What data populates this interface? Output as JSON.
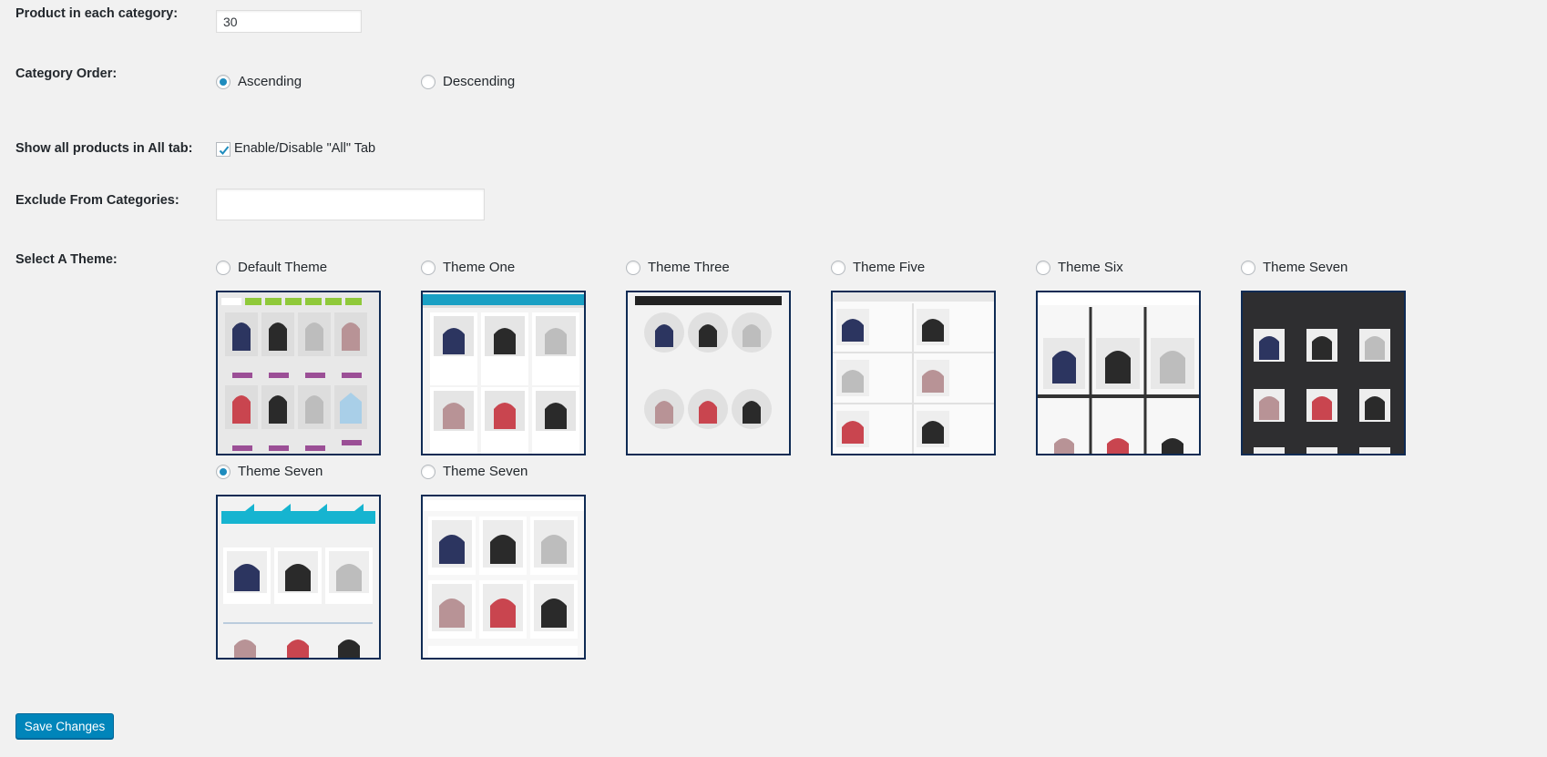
{
  "settings": {
    "product_count": {
      "label": "Product in each category:",
      "value": "30"
    },
    "category_order": {
      "label": "Category Order:",
      "options": [
        {
          "label": "Ascending",
          "checked": true
        },
        {
          "label": "Descending",
          "checked": false
        }
      ]
    },
    "all_tab": {
      "label": "Show all products in All tab:",
      "checkbox_label": "Enable/Disable \"All\" Tab",
      "checked": true
    },
    "exclude": {
      "label": "Exclude From Categories:",
      "value": ""
    },
    "theme": {
      "label": "Select A Theme:",
      "options": [
        {
          "label": "Default Theme",
          "checked": false
        },
        {
          "label": "Theme One",
          "checked": false
        },
        {
          "label": "Theme Three",
          "checked": false
        },
        {
          "label": "Theme Five",
          "checked": false
        },
        {
          "label": "Theme Six",
          "checked": false
        },
        {
          "label": "Theme Seven",
          "checked": false
        },
        {
          "label": "Theme Seven",
          "checked": true
        },
        {
          "label": "Theme Seven",
          "checked": false
        }
      ]
    }
  },
  "save_button": {
    "label": "Save Changes"
  },
  "colors": {
    "accent": "#0085ba",
    "radio_dot": "#1e8cbe",
    "thumb_border": "#0f2b54"
  }
}
